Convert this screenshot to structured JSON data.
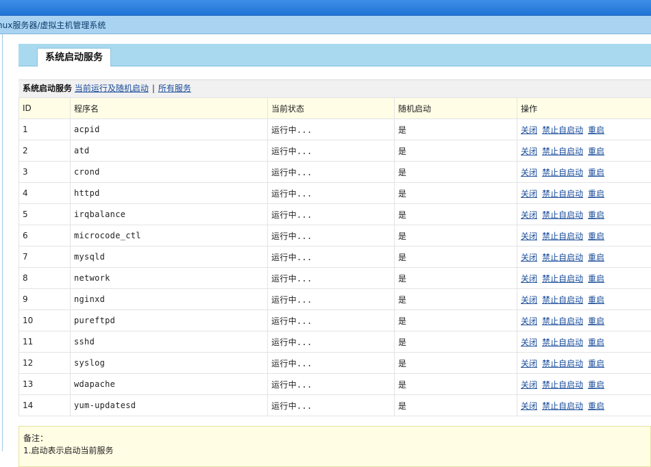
{
  "breadcrumb": "nux服务器/虚拟主机管理系统",
  "tab_title": "系统启动服务",
  "subnav": {
    "current": "系统启动服务",
    "link_running": "当前运行及随机启动",
    "separator": "|",
    "link_all": "所有服务"
  },
  "table": {
    "headers": [
      "ID",
      "程序名",
      "当前状态",
      "随机启动",
      "操作"
    ],
    "actions": {
      "close": "关闭",
      "disable": "禁止自启动",
      "restart": "重启"
    },
    "rows": [
      {
        "id": "1",
        "name": "acpid",
        "status": "运行中...",
        "autostart": "是"
      },
      {
        "id": "2",
        "name": "atd",
        "status": "运行中...",
        "autostart": "是"
      },
      {
        "id": "3",
        "name": "crond",
        "status": "运行中...",
        "autostart": "是"
      },
      {
        "id": "4",
        "name": "httpd",
        "status": "运行中...",
        "autostart": "是"
      },
      {
        "id": "5",
        "name": "irqbalance",
        "status": "运行中...",
        "autostart": "是"
      },
      {
        "id": "6",
        "name": "microcode_ctl",
        "status": "运行中...",
        "autostart": "是"
      },
      {
        "id": "7",
        "name": "mysqld",
        "status": "运行中...",
        "autostart": "是"
      },
      {
        "id": "8",
        "name": "network",
        "status": "运行中...",
        "autostart": "是"
      },
      {
        "id": "9",
        "name": "nginxd",
        "status": "运行中...",
        "autostart": "是"
      },
      {
        "id": "10",
        "name": "pureftpd",
        "status": "运行中...",
        "autostart": "是"
      },
      {
        "id": "11",
        "name": "sshd",
        "status": "运行中...",
        "autostart": "是"
      },
      {
        "id": "12",
        "name": "syslog",
        "status": "运行中...",
        "autostart": "是"
      },
      {
        "id": "13",
        "name": "wdapache",
        "status": "运行中...",
        "autostart": "是"
      },
      {
        "id": "14",
        "name": "yum-updatesd",
        "status": "运行中...",
        "autostart": "是"
      }
    ]
  },
  "note": {
    "title": "备注：",
    "line1": "1.启动表示启动当前服务"
  }
}
